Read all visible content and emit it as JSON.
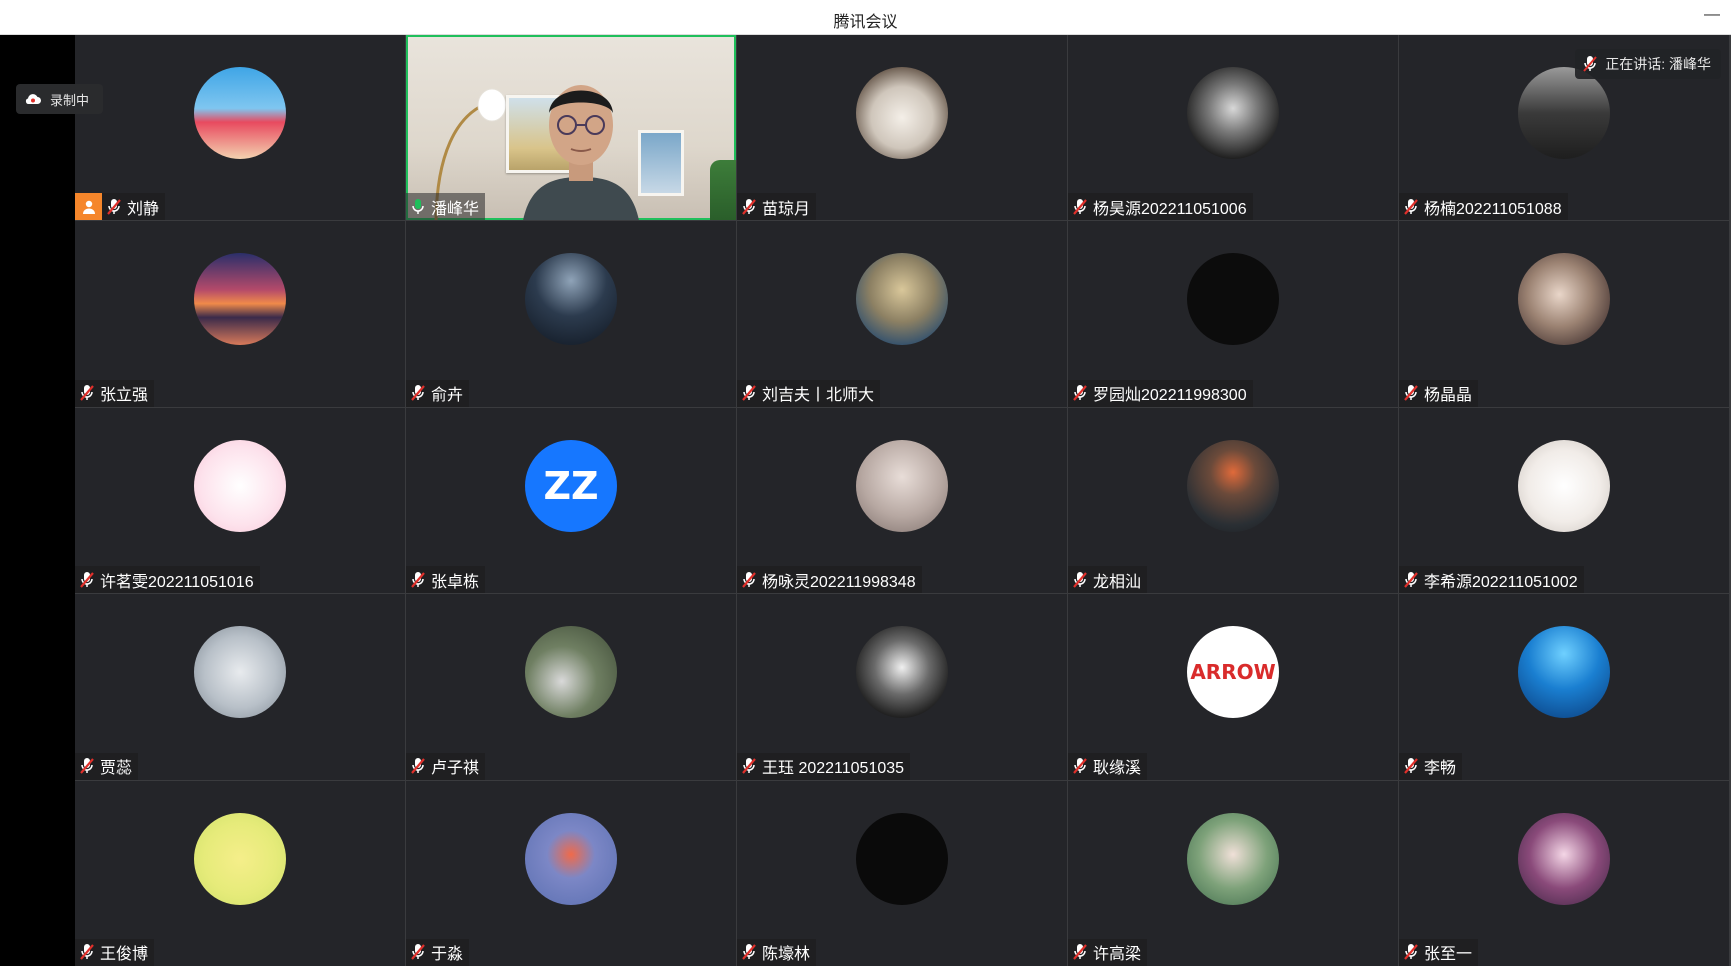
{
  "window": {
    "title": "腾讯会议",
    "minimize_label": "—"
  },
  "recording": {
    "label": "录制中"
  },
  "speaking": {
    "label": "正在讲话: 潘峰华"
  },
  "colors": {
    "background": "#242529",
    "grid_line": "#3a3b3e",
    "active_speaker_border": "#1fbf5b",
    "host_badge": "#f5862b",
    "mic_muted": "#e0302b",
    "mic_active": "#1fbf5b"
  },
  "participants": [
    {
      "name": "刘静",
      "mic": "muted",
      "host": true,
      "avatar_icon": "photo-avatar-icon",
      "avatar_bg": "linear-gradient(180deg,#3fa5e6 0%,#7fc6f0 45%,#e84a5f 60%,#f3d2b0 100%)"
    },
    {
      "name": "潘峰华",
      "mic": "active",
      "host": false,
      "video": true
    },
    {
      "name": "苗琼月",
      "mic": "muted",
      "host": false,
      "avatar_icon": "dog-avatar-icon",
      "avatar_bg": "radial-gradient(circle at 50% 55%,#f4efe8 0%,#cfc6bb 45%,#5a4a3d 80%)"
    },
    {
      "name": "杨昊源202211051006",
      "mic": "muted",
      "host": false,
      "avatar_icon": "portrait-avatar-icon",
      "avatar_bg": "radial-gradient(circle at 50% 45%,#d8d8d8 0%,#7a7a7a 35%,#1c1c1c 75%)"
    },
    {
      "name": "杨楠202211051088",
      "mic": "muted",
      "host": false,
      "avatar_icon": "room-avatar-icon",
      "avatar_bg": "linear-gradient(180deg,#9a9a9a 0%,#3a3a3a 50%,#1e1e1e 100%)"
    },
    {
      "name": "张立强",
      "mic": "muted",
      "host": false,
      "avatar_icon": "sunset-avatar-icon",
      "avatar_bg": "linear-gradient(180deg,#2b2f6a 0%,#b44a6a 40%,#f08a4a 55%,#3a2a4a 70%,#d87a5a 100%)"
    },
    {
      "name": "俞卉",
      "mic": "muted",
      "host": false,
      "avatar_icon": "night-couple-avatar-icon",
      "avatar_bg": "radial-gradient(circle at 50% 30%,#8fa3b8 0%,#2c3b4e 45%,#0f1620 100%)"
    },
    {
      "name": "刘吉夫丨北师大",
      "mic": "muted",
      "host": false,
      "avatar_icon": "straw-hat-avatar-icon",
      "avatar_bg": "radial-gradient(circle at 50% 40%,#d9c79a 0%,#8c8063 45%,#2f4f6e 80%)"
    },
    {
      "name": "罗园灿202211998300",
      "mic": "muted",
      "host": false,
      "avatar_icon": "cross-logo-avatar-icon",
      "avatar_bg": "#0c0c0c"
    },
    {
      "name": "杨晶晶",
      "mic": "muted",
      "host": false,
      "avatar_icon": "cat-girl-avatar-icon",
      "avatar_bg": "radial-gradient(circle at 45% 45%,#e9d6c9 0%,#9b8272 45%,#3a2a2a 90%)"
    },
    {
      "name": "许茗雯202211051016",
      "mic": "muted",
      "host": false,
      "avatar_icon": "cartoon-dog-avatar-icon",
      "avatar_bg": "radial-gradient(circle,#ffffff 0%,#fde2ec 60%,#f7c4d6 100%)"
    },
    {
      "name": "张卓栋",
      "mic": "muted",
      "host": false,
      "avatar_icon": "zz-logo-avatar-icon",
      "avatar_bg": "#1677ff",
      "avatar_text": "ZZ"
    },
    {
      "name": "杨咏灵202211998348",
      "mic": "muted",
      "host": false,
      "avatar_icon": "sweater-avatar-icon",
      "avatar_bg": "radial-gradient(circle at 50% 40%,#e8ddd8 0%,#b7a8a2 55%,#7d6f6b 100%)"
    },
    {
      "name": "龙相汕",
      "mic": "muted",
      "host": false,
      "avatar_icon": "wings-avatar-icon",
      "avatar_bg": "radial-gradient(circle at 50% 35%,#e06a3a 0%,#6b4a3a 30%,#2a2f34 70%,#1a1c1f 100%)"
    },
    {
      "name": "李希源202211051002",
      "mic": "muted",
      "host": false,
      "avatar_icon": "penguin-avatar-icon",
      "avatar_bg": "radial-gradient(circle at 50% 50%,#ffffff 0%,#f1ece8 55%,#c9c2bc 100%)"
    },
    {
      "name": "贾蕊",
      "mic": "muted",
      "host": false,
      "avatar_icon": "snow-avatar-icon",
      "avatar_bg": "radial-gradient(circle,#e8ebee 0%,#b8c0c8 55%,#7d8791 100%)"
    },
    {
      "name": "卢子祺",
      "mic": "muted",
      "host": false,
      "avatar_icon": "panda-avatar-icon",
      "avatar_bg": "radial-gradient(circle at 40% 60%,#d9d9d9 0%,#6f7f62 45%,#3e4a36 100%)"
    },
    {
      "name": "王珏 202211051035",
      "mic": "muted",
      "host": false,
      "avatar_icon": "anime-girl-avatar-icon",
      "avatar_bg": "radial-gradient(circle at 50% 45%,#f0f0f0 0%,#6a6a6a 40%,#111 80%)"
    },
    {
      "name": "耿缘溪",
      "mic": "muted",
      "host": false,
      "avatar_icon": "arrow-logo-avatar-icon",
      "avatar_bg": "#ffffff",
      "avatar_text": "ARROW"
    },
    {
      "name": "李畅",
      "mic": "muted",
      "host": false,
      "avatar_icon": "underwater-avatar-icon",
      "avatar_bg": "radial-gradient(circle at 50% 30%,#6fd0ff 0%,#1a7fd1 45%,#0a3b7a 100%)"
    },
    {
      "name": "王俊博",
      "mic": "muted",
      "host": false,
      "avatar_icon": "leaf-avatar-icon",
      "avatar_bg": "radial-gradient(circle,#f5ee8a 0%,#e6eb7a 55%,#cfe06a 100%)"
    },
    {
      "name": "于淼",
      "mic": "muted",
      "host": false,
      "avatar_icon": "cloud-avatar-icon",
      "avatar_bg": "radial-gradient(circle at 50% 45%,#f06a4a 0%,#7c87c6 35%,#5a6fb0 100%)"
    },
    {
      "name": "陈壕林",
      "mic": "muted",
      "host": false,
      "avatar_icon": "hat-man-avatar-icon",
      "avatar_bg": "#0a0a0a"
    },
    {
      "name": "许高梁",
      "mic": "muted",
      "host": false,
      "avatar_icon": "anime-schoolgirl-avatar-icon",
      "avatar_bg": "radial-gradient(circle at 50% 45%,#f0e0d8 0%,#7ea27a 50%,#3d6a4a 100%)"
    },
    {
      "name": "张至一",
      "mic": "muted",
      "host": false,
      "avatar_icon": "anime-purple-avatar-icon",
      "avatar_bg": "radial-gradient(circle at 50% 45%,#f4d6e6 0%,#8a4a7a 50%,#3a2340 100%)"
    }
  ]
}
